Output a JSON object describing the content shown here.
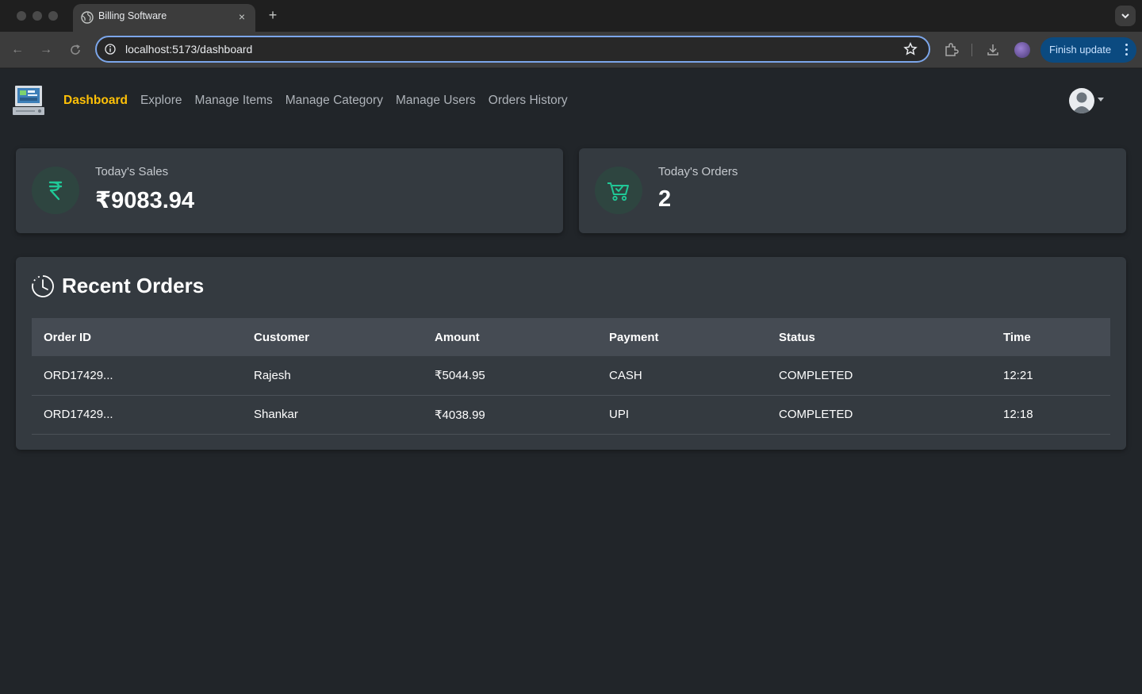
{
  "browser": {
    "tab_title": "Billing Software",
    "tab_close": "×",
    "new_tab": "+",
    "url": "localhost:5173/dashboard",
    "finish_update_label": "Finish update"
  },
  "nav": {
    "links": [
      {
        "label": "Dashboard",
        "active": true
      },
      {
        "label": "Explore"
      },
      {
        "label": "Manage Items"
      },
      {
        "label": "Manage Category"
      },
      {
        "label": "Manage Users"
      },
      {
        "label": "Orders History"
      }
    ]
  },
  "stats": {
    "sales": {
      "label": "Today's Sales",
      "value": "₹9083.94",
      "icon": "rupee-icon"
    },
    "orders": {
      "label": "Today's Orders",
      "value": "2",
      "icon": "cart-check-icon"
    }
  },
  "recent_orders": {
    "title": "Recent Orders",
    "columns": [
      "Order ID",
      "Customer",
      "Amount",
      "Payment",
      "Status",
      "Time"
    ],
    "rows": [
      [
        "ORD17429...",
        "Rajesh",
        "₹5044.95",
        "CASH",
        "COMPLETED",
        "12:21"
      ],
      [
        "ORD17429...",
        "Shankar",
        "₹4038.99",
        "UPI",
        "COMPLETED",
        "12:18"
      ]
    ]
  },
  "colors": {
    "accent": "#ffc107",
    "icon_green": "#20c997",
    "card_bg": "#343a40",
    "page_bg": "#212529"
  }
}
